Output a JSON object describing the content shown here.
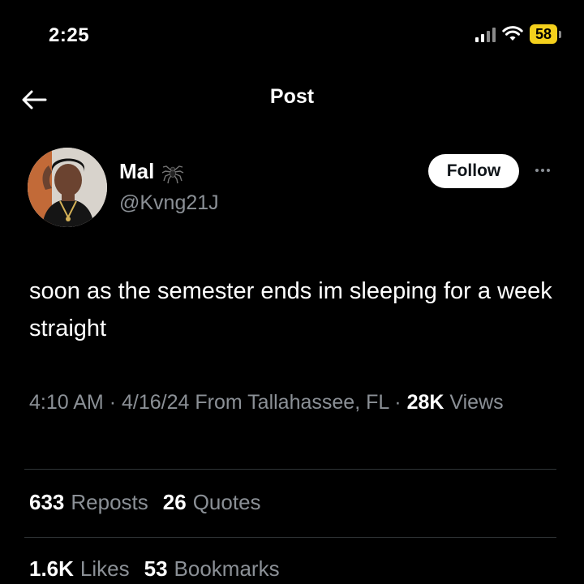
{
  "status_bar": {
    "time": "2:25",
    "battery": "58"
  },
  "header": {
    "title": "Post"
  },
  "author": {
    "display_name": "Mal",
    "handle": "@Kvng21J",
    "follow_label": "Follow"
  },
  "post": {
    "text": "soon as the semester ends im sleeping for a week straight",
    "time": "4:10 AM",
    "date": "4/16/24",
    "location": "From Tallahassee, FL",
    "views_count": "28K",
    "views_label": "Views",
    "separator": "·"
  },
  "stats": {
    "reposts_count": "633",
    "reposts_label": "Reposts",
    "quotes_count": "26",
    "quotes_label": "Quotes",
    "likes_count": "1.6K",
    "likes_label": "Likes",
    "bookmarks_count": "53",
    "bookmarks_label": "Bookmarks"
  },
  "colors": {
    "background": "#000000",
    "text_primary": "#e7e9ea",
    "text_secondary": "#8b9096",
    "battery": "#f4d01c"
  },
  "icons": [
    "back-arrow-icon",
    "signal-icon",
    "wifi-icon",
    "battery-icon",
    "spider-emoji-icon",
    "more-dots-icon"
  ]
}
